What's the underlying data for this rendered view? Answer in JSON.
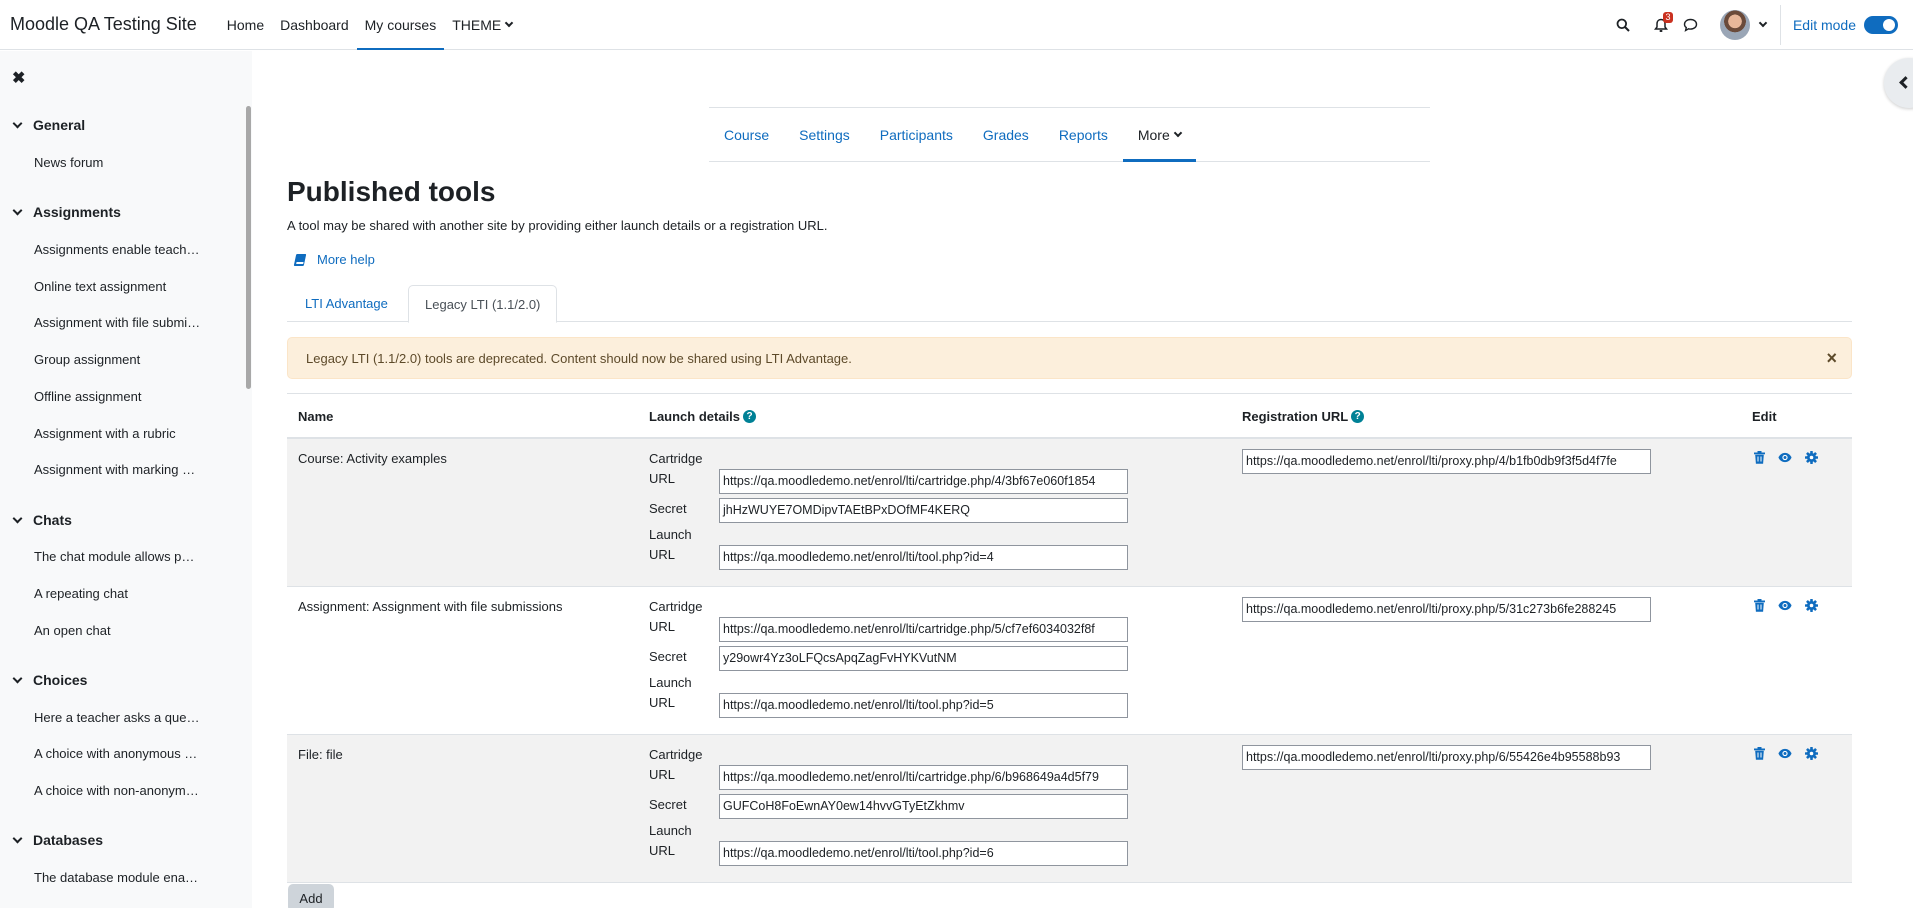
{
  "navbar": {
    "brand": "Moodle QA Testing Site",
    "links": [
      "Home",
      "Dashboard",
      "My courses",
      "THEME"
    ],
    "notification_count": "3",
    "edit_mode_label": "Edit mode"
  },
  "drawer": {
    "sections": [
      {
        "title": "General",
        "items": [
          "News forum"
        ]
      },
      {
        "title": "Assignments",
        "items": [
          "Assignments enable teach…",
          "Online text assignment",
          "Assignment with file submi…",
          "Group assignment",
          "Offline assignment",
          "Assignment with a rubric",
          "Assignment with marking …"
        ]
      },
      {
        "title": "Chats",
        "items": [
          "The chat module allows p…",
          "A repeating chat",
          "An open chat"
        ]
      },
      {
        "title": "Choices",
        "items": [
          "Here a teacher asks a que…",
          "A choice with anonymous …",
          "A choice with non-anonym…"
        ]
      },
      {
        "title": "Databases",
        "items": [
          "The database module ena…"
        ]
      }
    ]
  },
  "secondary_nav": [
    "Course",
    "Settings",
    "Participants",
    "Grades",
    "Reports",
    "More"
  ],
  "page": {
    "title": "Published tools",
    "description": "A tool may be shared with another site by providing either launch details or a registration URL.",
    "more_help": "More help"
  },
  "tabs": [
    "LTI Advantage",
    "Legacy LTI (1.1/2.0)"
  ],
  "alert": {
    "text": "Legacy LTI (1.1/2.0) tools are deprecated. Content should now be shared using LTI Advantage.",
    "close": "×"
  },
  "table": {
    "headers": {
      "name": "Name",
      "launch": "Launch details",
      "registration": "Registration URL",
      "edit": "Edit",
      "help": "?"
    },
    "labels": {
      "cartridge": "Cartridge",
      "url": "URL",
      "secret": "Secret",
      "launch": "Launch"
    },
    "rows": [
      {
        "name": "Course: Activity examples",
        "cartridge_url": "https://qa.moodledemo.net/enrol/lti/cartridge.php/4/3bf67e060f1854",
        "secret": "jhHzWUYE7OMDipvTAEtBPxDOfMF4KERQ",
        "launch_url": "https://qa.moodledemo.net/enrol/lti/tool.php?id=4",
        "registration_url": "https://qa.moodledemo.net/enrol/lti/proxy.php/4/b1fb0db9f3f5d4f7fe"
      },
      {
        "name": "Assignment: Assignment with file submissions",
        "cartridge_url": "https://qa.moodledemo.net/enrol/lti/cartridge.php/5/cf7ef6034032f8f",
        "secret": "y29owr4Yz3oLFQcsApqZagFvHYKVutNM",
        "launch_url": "https://qa.moodledemo.net/enrol/lti/tool.php?id=5",
        "registration_url": "https://qa.moodledemo.net/enrol/lti/proxy.php/5/31c273b6fe288245"
      },
      {
        "name": "File: file",
        "cartridge_url": "https://qa.moodledemo.net/enrol/lti/cartridge.php/6/b968649a4d5f79",
        "secret": "GUFCoH8FoEwnAY0ew14hvvGTyEtZkhmv",
        "launch_url": "https://qa.moodledemo.net/enrol/lti/tool.php?id=6",
        "registration_url": "https://qa.moodledemo.net/enrol/lti/proxy.php/6/55426e4b95588b93"
      }
    ]
  },
  "add_button": "Add",
  "colors": {
    "primary": "#0f6cbf",
    "alert_bg": "#fcefdc",
    "help": "#008196"
  }
}
